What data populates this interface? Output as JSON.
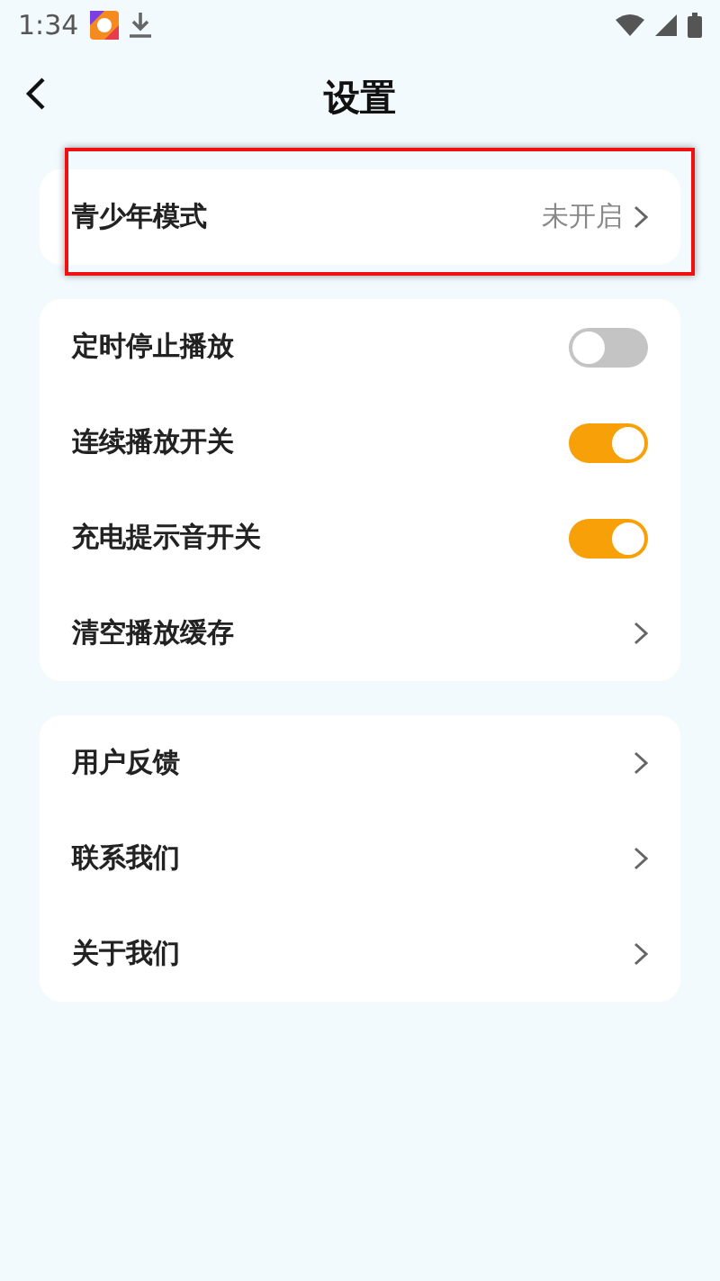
{
  "status_bar": {
    "time": "1:34"
  },
  "header": {
    "title": "设置"
  },
  "groups": [
    {
      "items": [
        {
          "kind": "link",
          "label": "青少年模式",
          "value": "未开启",
          "highlighted": true
        }
      ]
    },
    {
      "items": [
        {
          "kind": "toggle",
          "label": "定时停止播放",
          "on": false
        },
        {
          "kind": "toggle",
          "label": "连续播放开关",
          "on": true
        },
        {
          "kind": "toggle",
          "label": "充电提示音开关",
          "on": true
        },
        {
          "kind": "link",
          "label": "清空播放缓存"
        }
      ]
    },
    {
      "items": [
        {
          "kind": "link",
          "label": "用户反馈"
        },
        {
          "kind": "link",
          "label": "联系我们"
        },
        {
          "kind": "link",
          "label": "关于我们"
        }
      ]
    }
  ]
}
